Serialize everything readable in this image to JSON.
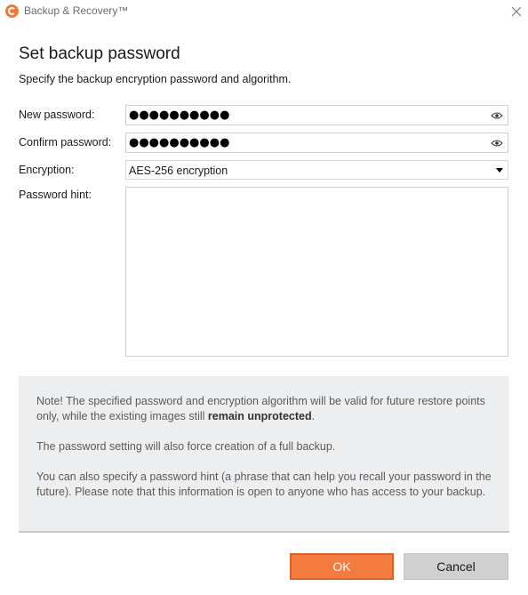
{
  "window": {
    "title": "Backup & Recovery™",
    "logo_icon": "app-logo-icon",
    "close_icon": "close-icon"
  },
  "header": {
    "title": "Set backup password",
    "subtitle": "Specify the backup encryption password and algorithm."
  },
  "form": {
    "new_password": {
      "label": "New password:",
      "masked_value": "●●●●●●●●●●",
      "icon": "eye-icon"
    },
    "confirm_password": {
      "label": "Confirm password:",
      "masked_value": "●●●●●●●●●●",
      "icon": "eye-icon"
    },
    "encryption": {
      "label": "Encryption:",
      "selected": "AES-256 encryption",
      "icon": "chevron-down-icon"
    },
    "password_hint": {
      "label": "Password hint:",
      "value": ""
    }
  },
  "note": {
    "para1_text": "Note! The specified password and encryption algorithm will be valid for future restore points only, while the existing images still ",
    "para1_bold": "remain unprotected",
    "para1_end": ".",
    "para2": "The password setting will also force creation of a full backup.",
    "para3": "You can also specify a password hint (a phrase that can help you recall your password in the future). Please note that this information is open to anyone who has access to your backup."
  },
  "buttons": {
    "ok": "OK",
    "cancel": "Cancel"
  },
  "colors": {
    "accent": "#f47b3f",
    "note_background": "#edeef0",
    "cancel_background": "#d0d0d0"
  }
}
